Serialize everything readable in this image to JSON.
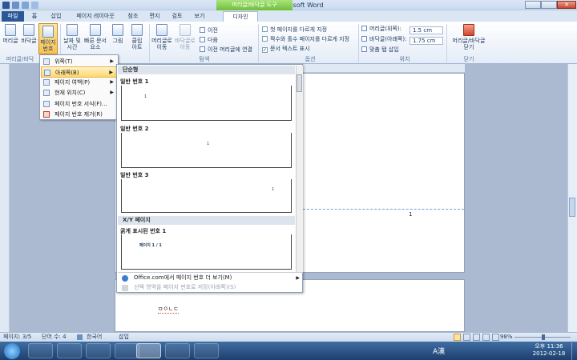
{
  "window": {
    "title": "문서2 - Microsoft Word",
    "context_tab": "머리글/바닥글 도구"
  },
  "tabs": [
    {
      "label": "파일"
    },
    {
      "label": "홈"
    },
    {
      "label": "삽입"
    },
    {
      "label": "페이지 레이아웃"
    },
    {
      "label": "참조"
    },
    {
      "label": "편지"
    },
    {
      "label": "검토"
    },
    {
      "label": "보기"
    },
    {
      "label": "디자인"
    }
  ],
  "ribbon": {
    "header_btn": "머리글",
    "footer_btn": "바닥글",
    "page_num_btn_1": "페이지",
    "page_num_btn_2": "번호",
    "datetime_1": "날짜 및",
    "datetime_2": "시간",
    "quickparts_1": "빠른 문서",
    "quickparts_2": "요소",
    "picture": "그림",
    "clipart_1": "클립",
    "clipart_2": "아트",
    "goto_header_1": "머리글로",
    "goto_header_2": "이동",
    "goto_footer_1": "바닥글로",
    "goto_footer_2": "이동",
    "prev": "이전",
    "next": "다음",
    "link_prev": "이전 머리글에 연결",
    "opt_first": "첫 페이지를 다르게 지정",
    "opt_oddeven": "짝수와 홀수 페이지를 다르게 지정",
    "opt_showtext": "문서 텍스트 표시",
    "header_pos_label": "머리글(위쪽):",
    "header_pos_value": "1.5 cm",
    "footer_pos_label": "바닥글(아래쪽):",
    "footer_pos_value": "1.75 cm",
    "align_tab": "맞춤 탭 삽입",
    "close_1": "머리글/바닥글",
    "close_2": "닫기",
    "group_hf": "머리글/바닥",
    "group_nav": "탐색",
    "group_opt": "옵션",
    "group_pos": "위치",
    "group_close": "닫기"
  },
  "menu": {
    "items": [
      {
        "label": "위쪽(T)",
        "sub": true
      },
      {
        "label": "아래쪽(B)",
        "sub": true
      },
      {
        "label": "페이지 여백(P)",
        "sub": true
      },
      {
        "label": "현재 위치(C)",
        "sub": true
      },
      {
        "label": "페이지 번호 서식(F)...",
        "sub": false
      },
      {
        "label": "페이지 번호 제거(R)",
        "sub": false
      }
    ]
  },
  "gallery": {
    "section1": "단순형",
    "item1": "일반 번호 1",
    "item2": "일반 번호 2",
    "item3": "일반 번호 3",
    "section2": "X/Y 페이지",
    "item4": "굵게 표시된 번호 1",
    "thumb_num": "1",
    "thumb_xy": "페이지 1 / 1",
    "more": "Office.com에서 페이지 번호 더 보기(M)",
    "save": "선택 영역을 페이지 번호로 저장(아래쪽)(S)"
  },
  "document": {
    "page_number": "1",
    "body_word": "ㅁㅇㄴㄷ"
  },
  "status": {
    "page": "페이지: 3/5",
    "words": "단어 수: 4",
    "lang": "한국어",
    "mode": "삽입",
    "zoom": "98%"
  },
  "taskbar": {
    "ime": "A漢",
    "time": "오후 11:36",
    "date": "2012-02-18"
  },
  "colors": {
    "context_tab": "#6fbe3c",
    "file_tab": "#2b5797",
    "taskbar": "#2a5184",
    "highlight": "#ffd86b"
  }
}
